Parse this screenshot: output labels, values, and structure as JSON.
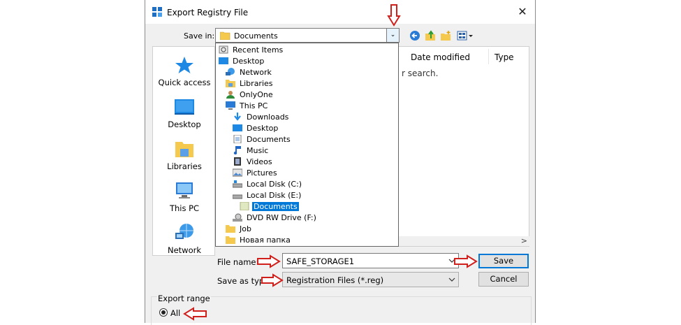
{
  "window": {
    "title": "Export Registry File",
    "close": "✕"
  },
  "toolbar": {
    "save_in_label": "Save in:",
    "save_in_value": "Documents",
    "dropdown_glyph": "⌄"
  },
  "places": [
    {
      "label": "Quick access",
      "icon": "quick-access-icon"
    },
    {
      "label": "Desktop",
      "icon": "desktop-icon"
    },
    {
      "label": "Libraries",
      "icon": "libraries-icon"
    },
    {
      "label": "This PC",
      "icon": "this-pc-icon"
    },
    {
      "label": "Network",
      "icon": "network-icon"
    }
  ],
  "file_list": {
    "columns": [
      "Date modified",
      "Type"
    ],
    "empty_text": "r search.",
    "scroll_right": ">"
  },
  "save_in_dropdown": [
    {
      "label": "Recent Items",
      "icon": "recent-items-icon",
      "indent": 0
    },
    {
      "label": "Desktop",
      "icon": "desktop-icon",
      "indent": 0
    },
    {
      "label": "Network",
      "icon": "network-icon",
      "indent": 1
    },
    {
      "label": "Libraries",
      "icon": "libraries-icon",
      "indent": 1
    },
    {
      "label": "OnlyOne",
      "icon": "user-icon",
      "indent": 1
    },
    {
      "label": "This PC",
      "icon": "this-pc-icon",
      "indent": 1
    },
    {
      "label": "Downloads",
      "icon": "downloads-icon",
      "indent": 2
    },
    {
      "label": "Desktop",
      "icon": "desktop-icon",
      "indent": 2
    },
    {
      "label": "Documents",
      "icon": "documents-icon",
      "indent": 2
    },
    {
      "label": "Music",
      "icon": "music-icon",
      "indent": 2
    },
    {
      "label": "Videos",
      "icon": "videos-icon",
      "indent": 2
    },
    {
      "label": "Pictures",
      "icon": "pictures-icon",
      "indent": 2
    },
    {
      "label": "Local Disk (C:)",
      "icon": "drive-icon",
      "indent": 2
    },
    {
      "label": "Local Disk (E:)",
      "icon": "drive-icon",
      "indent": 2
    },
    {
      "label": "Documents",
      "icon": "folder-icon",
      "indent": 3,
      "selected": true
    },
    {
      "label": "DVD RW Drive (F:)",
      "icon": "dvd-icon",
      "indent": 2
    },
    {
      "label": "Job",
      "icon": "folder-icon",
      "indent": 1
    },
    {
      "label": "Новая папка",
      "icon": "folder-icon",
      "indent": 1
    }
  ],
  "form": {
    "file_name_label": "File name:",
    "file_name_value": "SAFE_STORAGE1",
    "save_as_type_label": "Save as type:",
    "save_as_type_value": "Registration Files (*.reg)",
    "save_button": "Save",
    "cancel_button": "Cancel"
  },
  "export_range": {
    "label": "Export range",
    "all_label": "All",
    "all_selected": true
  },
  "colors": {
    "accent": "#0078d7",
    "annotation_arrow": "#d0201c",
    "folder": "#f5c94e"
  }
}
